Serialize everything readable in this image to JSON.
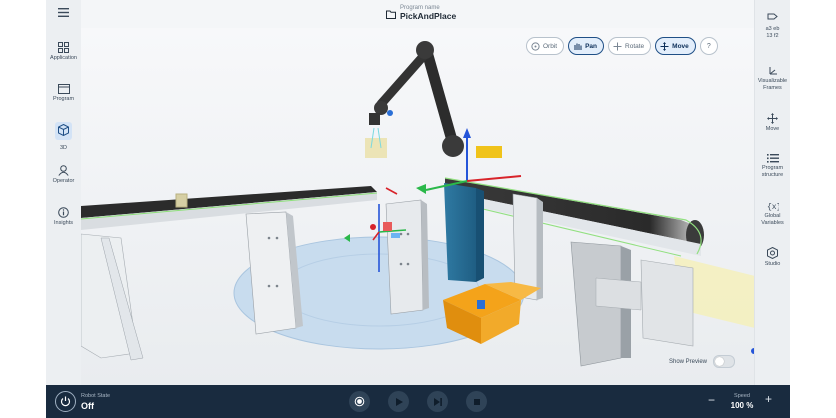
{
  "header": {
    "program_sublabel": "Program name",
    "program_name": "PickAndPlace"
  },
  "left_nav": {
    "items": [
      {
        "label": "Application",
        "icon": "grid-icon"
      },
      {
        "label": "Program",
        "icon": "folder-icon"
      },
      {
        "label": "3D",
        "icon": "cube-icon",
        "active": true
      },
      {
        "label": "Operator",
        "icon": "person-icon"
      },
      {
        "label": "Insights",
        "icon": "info-icon"
      }
    ]
  },
  "right_nav": {
    "status": {
      "line1": "a3 eb",
      "line2": "13 f2"
    },
    "items": [
      {
        "label": "Visualizable Frames",
        "icon": "frames-icon"
      },
      {
        "label": "Move",
        "icon": "move-icon"
      },
      {
        "label": "Program structure",
        "icon": "list-icon"
      },
      {
        "label": "Global Variables",
        "icon": "variables-icon"
      },
      {
        "label": "Studio",
        "icon": "studio-icon"
      }
    ]
  },
  "view_controls": {
    "orbit": "Orbit",
    "pan": "Pan",
    "rotate": "Rotate",
    "move": "Move",
    "help": "?"
  },
  "preview": {
    "label": "Show Preview",
    "enabled": false
  },
  "footer": {
    "robot_state_label": "Robot State",
    "robot_state_value": "Off",
    "speed_label": "Speed",
    "speed_value": "100 %"
  },
  "colors": {
    "footer_bg": "#192b3f",
    "accent": "#1f4f86",
    "scene_platform": "#c8dcee"
  }
}
